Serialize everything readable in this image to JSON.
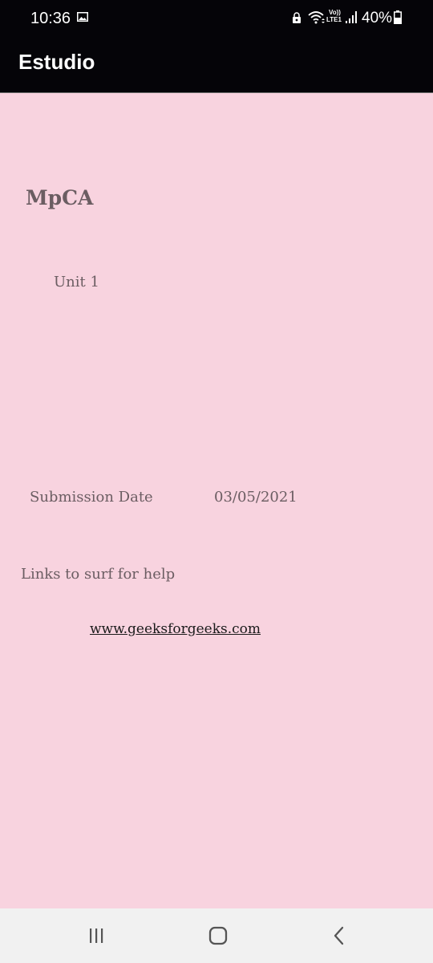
{
  "status_bar": {
    "time": "10:36",
    "battery_percent": "40%",
    "volte_top": "Vo))",
    "volte_bottom": "LTE1",
    "icons": [
      "gallery-icon",
      "lock-icon",
      "wifi-icon",
      "volte-icon",
      "signal-icon",
      "battery-icon"
    ]
  },
  "app_bar": {
    "title": "Estudio"
  },
  "main": {
    "course_title": "MpCA",
    "unit": "Unit 1",
    "submission_label": "Submission Date",
    "submission_date": "03/05/2021",
    "links_heading": "Links to surf for help",
    "link": "www.geeksforgeeks.com"
  },
  "nav_bar": {
    "buttons": [
      "recents-icon",
      "home-icon",
      "back-icon"
    ]
  },
  "colors": {
    "background": "#f8d3df",
    "app_bar": "#050408",
    "text": "#6b5d62",
    "link": "#1b1b1b",
    "nav_bar": "#f1f1f1"
  }
}
